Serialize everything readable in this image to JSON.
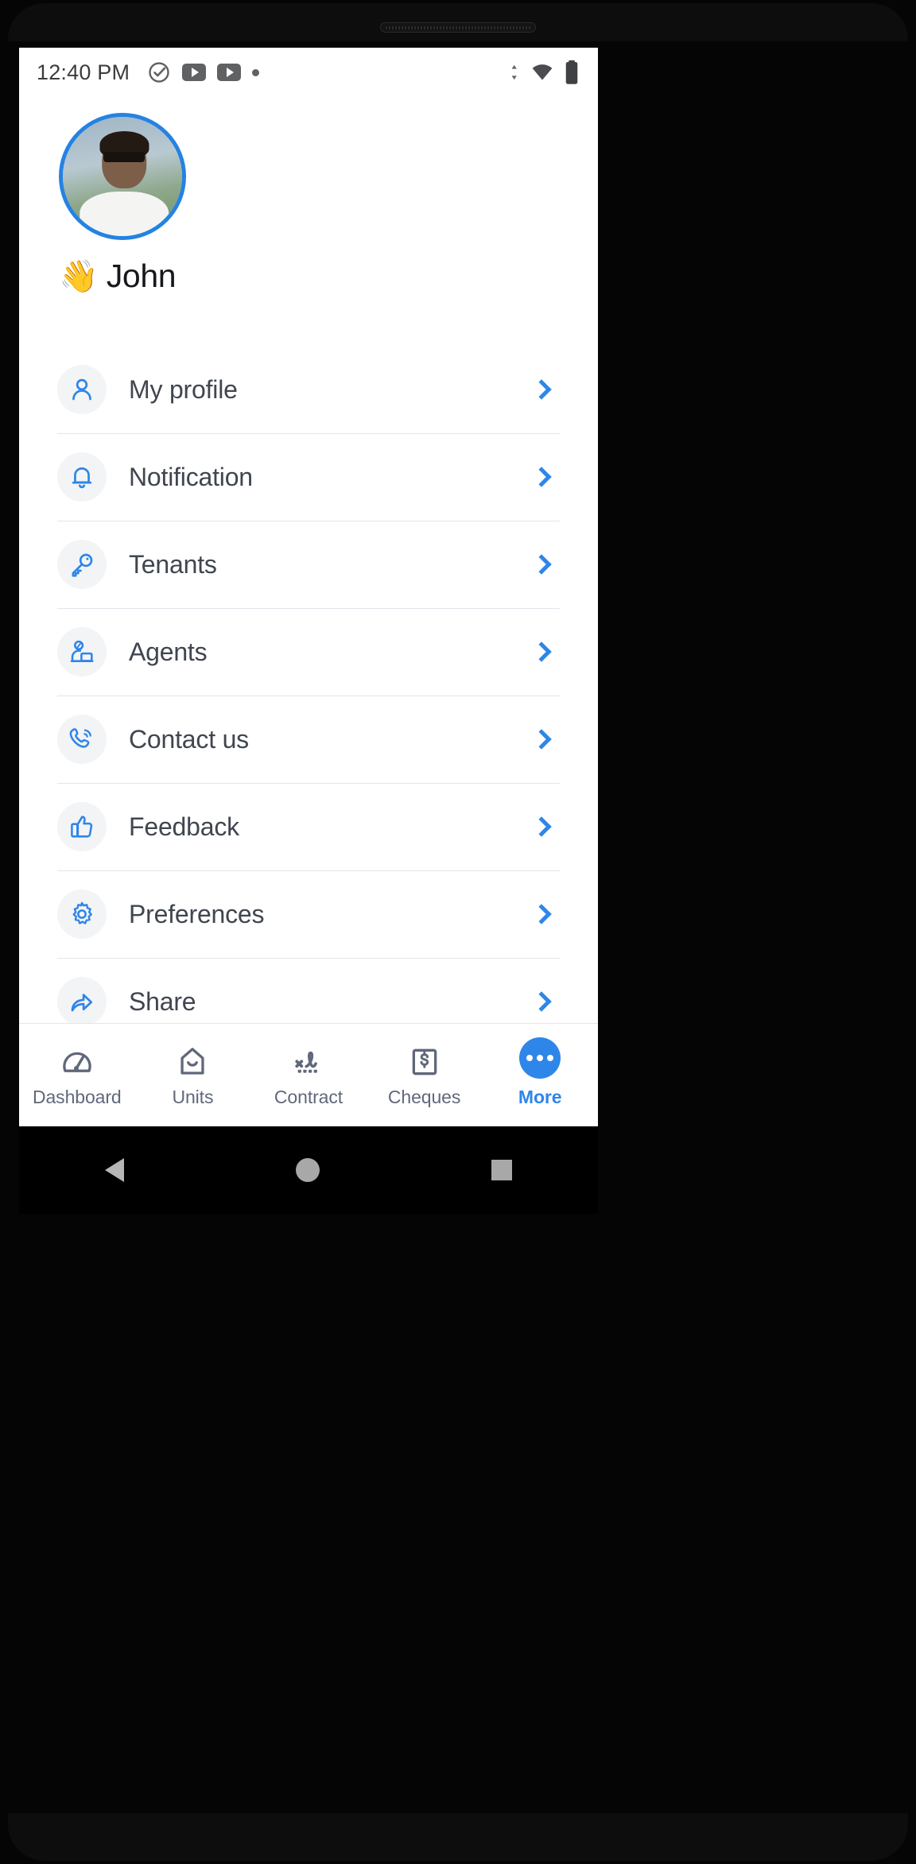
{
  "statusbar": {
    "time": "12:40 PM",
    "icons": [
      "check-circle-icon",
      "youtube-icon",
      "youtube-icon",
      "dot-icon"
    ],
    "right_icons": [
      "data-transfer-icon",
      "wifi-icon",
      "battery-icon"
    ]
  },
  "profile": {
    "avatar_alt": "user-avatar",
    "wave_emoji": "👋",
    "name": "John"
  },
  "menu": {
    "items": [
      {
        "label": "My profile",
        "icon": "person-icon",
        "chevron": "chevron-right-icon"
      },
      {
        "label": "Notification",
        "icon": "bell-icon",
        "chevron": "chevron-right-icon"
      },
      {
        "label": "Tenants",
        "icon": "key-icon",
        "chevron": "chevron-right-icon"
      },
      {
        "label": "Agents",
        "icon": "agent-icon",
        "chevron": "chevron-right-icon"
      },
      {
        "label": "Contact us",
        "icon": "phone-call-icon",
        "chevron": "chevron-right-icon"
      },
      {
        "label": "Feedback",
        "icon": "thumbs-up-icon",
        "chevron": "chevron-right-icon"
      },
      {
        "label": "Preferences",
        "icon": "gear-icon",
        "chevron": "chevron-right-icon"
      },
      {
        "label": "Share",
        "icon": "share-icon",
        "chevron": "chevron-right-icon"
      }
    ]
  },
  "tabbar": {
    "items": [
      {
        "label": "Dashboard",
        "icon": "speedometer-icon",
        "active": false
      },
      {
        "label": "Units",
        "icon": "house-icon",
        "active": false
      },
      {
        "label": "Contract",
        "icon": "signature-icon",
        "active": false
      },
      {
        "label": "Cheques",
        "icon": "dollar-note-icon",
        "active": false
      },
      {
        "label": "More",
        "icon": "ellipsis-icon",
        "active": true
      }
    ]
  },
  "navbar": {
    "back": "back-triangle-icon",
    "home": "home-circle-icon",
    "recents": "recents-square-icon"
  },
  "colors": {
    "accent": "#2e86e8",
    "icon_bg": "#f3f4f6",
    "text": "#40464f",
    "tab_inactive": "#60687a"
  }
}
